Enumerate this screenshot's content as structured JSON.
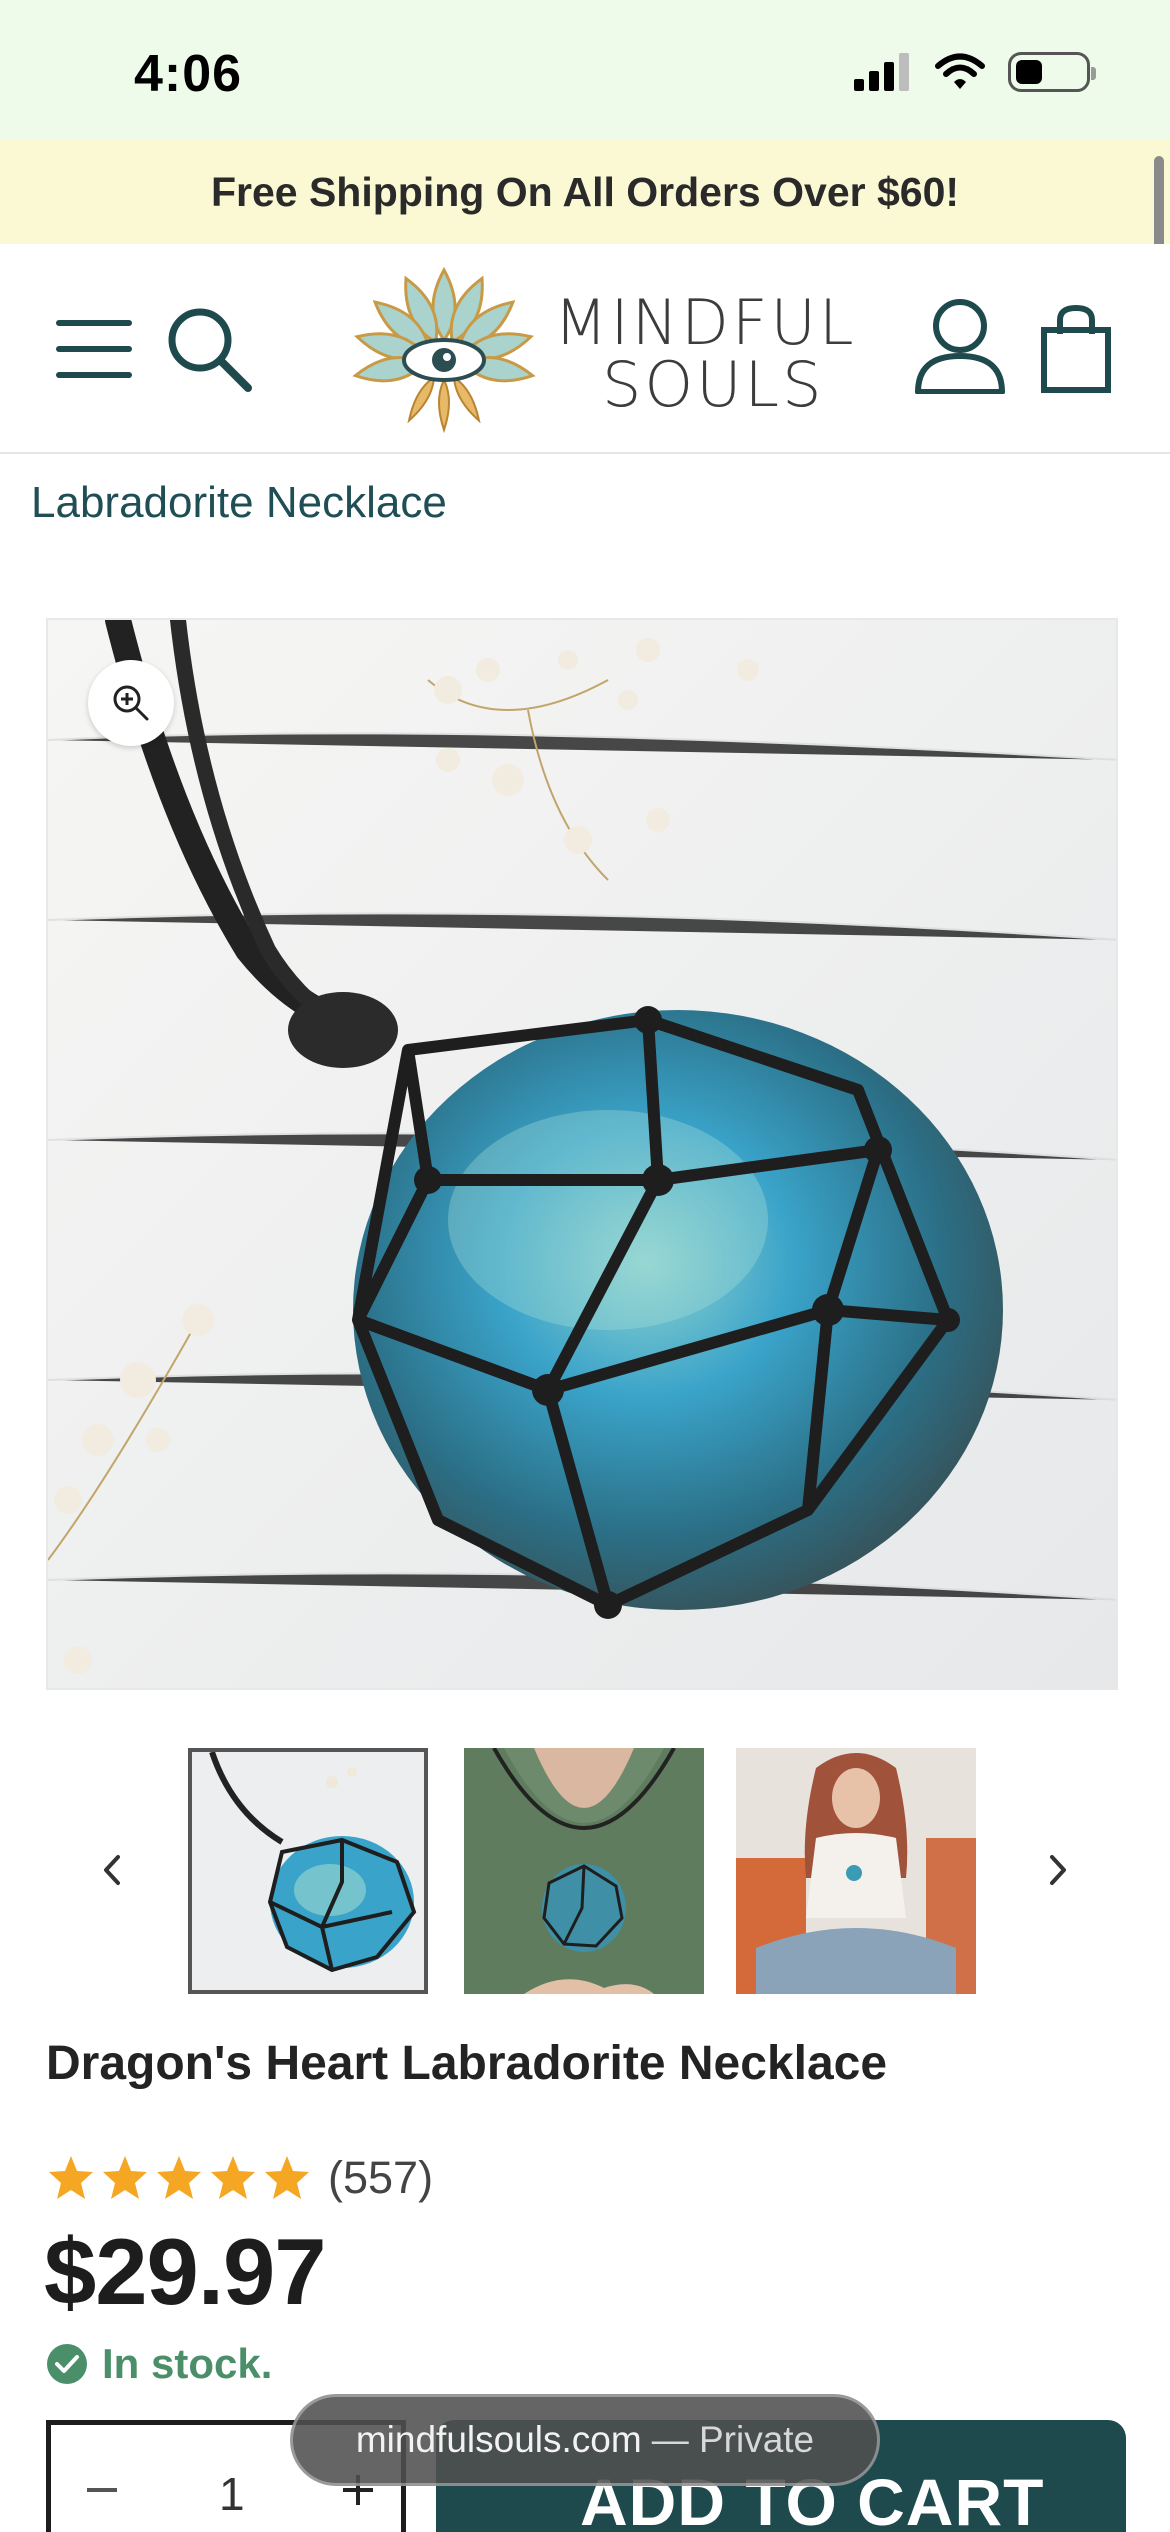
{
  "status_bar": {
    "time": "4:06"
  },
  "announcement": "Free Shipping On All Orders Over $60!",
  "header": {
    "brand_line1": "MINDFUL",
    "brand_line2": "SOULS"
  },
  "breadcrumb": "Labradorite Necklace",
  "product": {
    "title": "Dragon's Heart Labradorite Necklace",
    "rating": 5,
    "rating_count": "(557)",
    "price": "$29.97",
    "stock": "In stock.",
    "quantity": "1",
    "add_to_cart": "ADD TO CART"
  },
  "gallery": {
    "active_index": 0,
    "thumb_count": 3
  },
  "browser": {
    "domain": "mindfulsouls.com",
    "mode": "— Private"
  },
  "colors": {
    "status_bg": "#eefbea",
    "announce_bg": "#fbf9d4",
    "brand_dark": "#1e4a4e",
    "star": "#f5a623",
    "stock_green": "#4b8f6a"
  },
  "icons": [
    "menu-icon",
    "search-icon",
    "account-icon",
    "cart-icon",
    "zoom-icon",
    "chevron-left-icon",
    "chevron-right-icon",
    "star-icon",
    "check-circle-icon",
    "minus-icon",
    "plus-icon"
  ]
}
